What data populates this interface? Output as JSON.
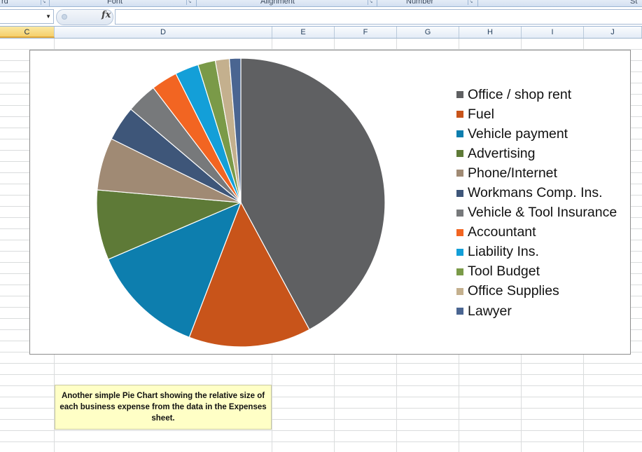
{
  "ribbon": {
    "groups": [
      {
        "label": "rd"
      },
      {
        "label": "Font"
      },
      {
        "label": "Alignment"
      },
      {
        "label": "Number"
      },
      {
        "label": "St"
      }
    ]
  },
  "formula_bar": {
    "name_box_value": "",
    "fx_label": "fx",
    "formula_value": ""
  },
  "columns": [
    "C",
    "D",
    "E",
    "F",
    "G",
    "H",
    "I",
    "J"
  ],
  "selected_column": "C",
  "colors": {
    "Office / shop rent": "#5f6062",
    "Fuel": "#c8541a",
    "Vehicle payment": "#0d7eae",
    "Advertising": "#5e7a37",
    "Phone/Internet": "#a08a74",
    "Workmans Comp. Ins.": "#3e5679",
    "Vehicle & Tool Insurance": "#77797b",
    "Accountant": "#f26522",
    "Liability Ins.": "#139fd8",
    "Tool Budget": "#7a9a48",
    "Office Supplies": "#c4b08e",
    "Lawyer": "#4a6591"
  },
  "chart_data": {
    "type": "pie",
    "title": "",
    "legend_position": "right",
    "labels": [
      "Office / shop rent",
      "Fuel",
      "Vehicle payment",
      "Advertising",
      "Phone/Internet",
      "Workmans Comp. Ins.",
      "Vehicle & Tool Insurance",
      "Accountant",
      "Liability Ins.",
      "Tool Budget",
      "Office Supplies",
      "Lawyer"
    ],
    "values": [
      43.0,
      14.0,
      13.0,
      8.0,
      6.0,
      4.0,
      3.5,
      3.0,
      2.7,
      2.0,
      1.6,
      1.3
    ]
  },
  "note": {
    "text": "Another simple Pie Chart showing the relative size of each business expense from the data in the Expenses sheet."
  }
}
